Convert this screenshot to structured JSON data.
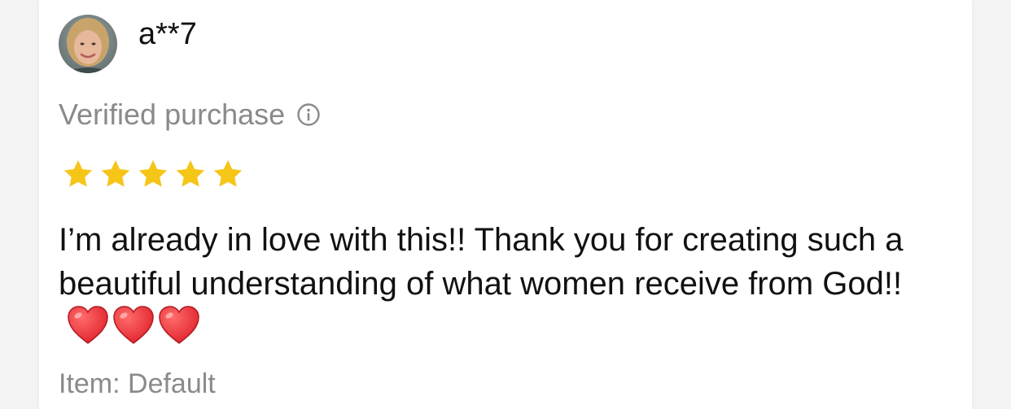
{
  "review": {
    "username": "a**7",
    "verified_label": "Verified purchase",
    "rating": 5,
    "rating_max": 5,
    "text": "I’m already in love with this!! Thank you for creating such a beautiful understanding of what women receive from God!!",
    "emoji": "❤️❤️❤️",
    "item_label": "Item: Default"
  },
  "icons": {
    "avatar": "user-photo",
    "verified_info": "info-circle-icon",
    "star": "star-icon",
    "heart": "red-heart-emoji"
  },
  "colors": {
    "star": "#F5C518",
    "heart": "#E0242C",
    "muted_text": "#8A8A8A",
    "primary_text": "#111111"
  }
}
